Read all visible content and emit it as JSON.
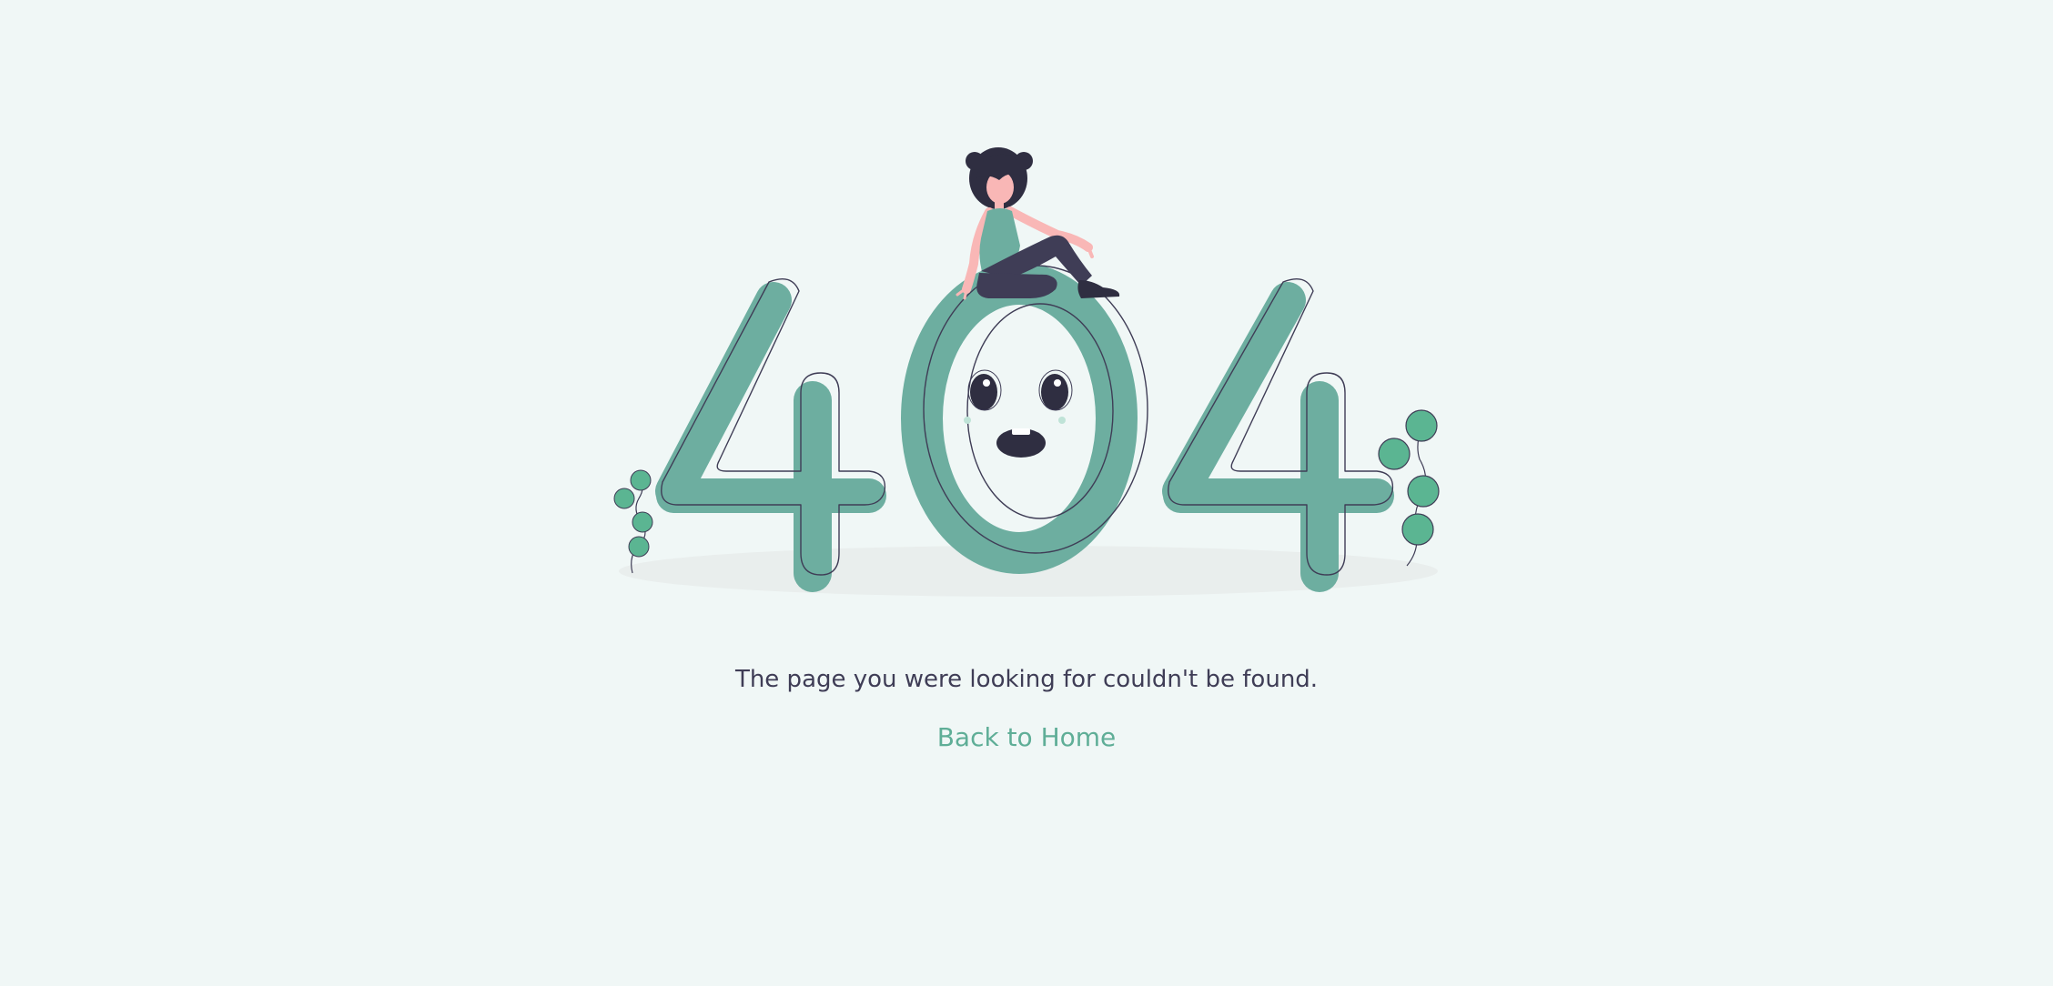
{
  "message": "The page you were looking for couldn't be found.",
  "back_link": "Back to Home",
  "illustration": {
    "digits": "404",
    "icon": "girl-sitting-on-404-icon"
  },
  "colors": {
    "background": "#f0f7f6",
    "digit_fill": "#6daea0",
    "outline": "#3f3d56",
    "leaf": "#5bb592",
    "hair": "#2f2e41",
    "skin": "#f9b7b6",
    "link": "#5fae97",
    "text": "#3f3d56"
  }
}
